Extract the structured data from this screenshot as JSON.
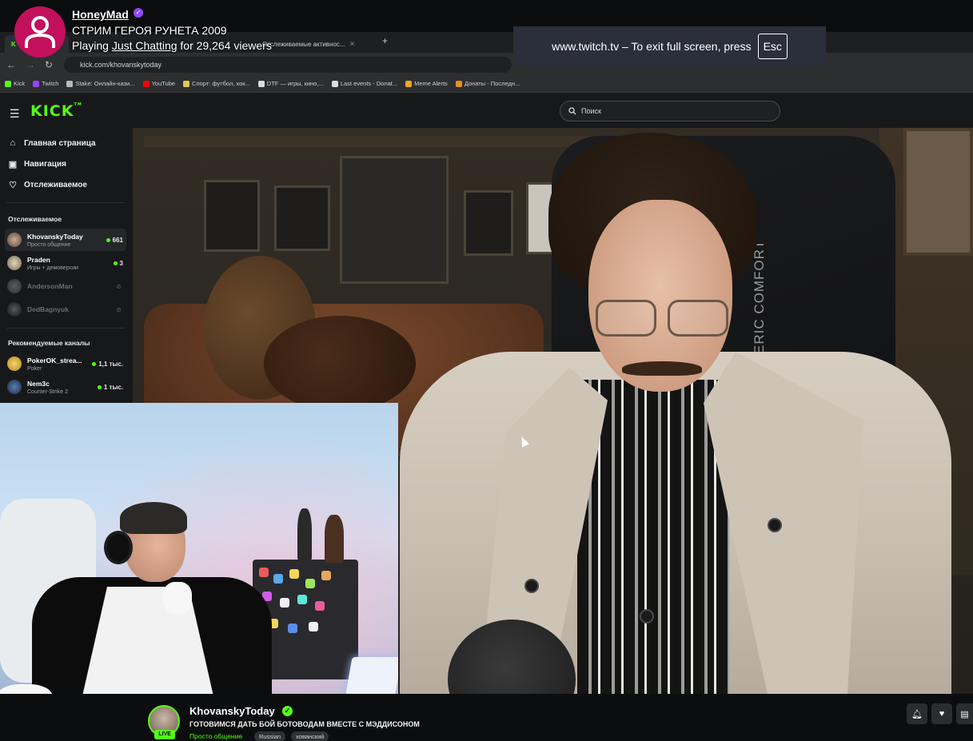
{
  "twitch": {
    "channel_name": "HoneyMad",
    "stream_title": "СТРИМ ГЕРОЯ РУНЕТА 2009",
    "playing_prefix": "Playing",
    "game": "Just Chatting",
    "viewers_text": "for 29,264 viewers"
  },
  "fullscreen_notice": {
    "text": "www.twitch.tv – To exit full screen, press",
    "key": "Esc"
  },
  "browser": {
    "tabs": [
      {
        "label": "K"
      },
      {
        "label": "Отслеживаемые активнос..."
      }
    ],
    "url": "kick.com/khovanskytoday",
    "bookmarks": [
      {
        "label": "Kick",
        "color": "#53fc18"
      },
      {
        "label": "Twitch",
        "color": "#9147ff"
      },
      {
        "label": "Stake: Онлайн-кази...",
        "color": "#bbbbbb"
      },
      {
        "label": "YouTube",
        "color": "#ff0000"
      },
      {
        "label": "Спорт: футбол, хок...",
        "color": "#e2c94a"
      },
      {
        "label": "DTF — игры, кино,...",
        "color": "#dddddd"
      },
      {
        "label": "Last events - Donat...",
        "color": "#dddddd"
      },
      {
        "label": "Meme Alerts",
        "color": "#f2a623"
      },
      {
        "label": "Донаты - Последн...",
        "color": "#f28c1c"
      }
    ]
  },
  "kick": {
    "logo": "KICK",
    "logo_mark": "TM",
    "search_placeholder": "Поиск",
    "nav": [
      {
        "label": "Главная страница",
        "icon": "home-icon"
      },
      {
        "label": "Навигация",
        "icon": "compass-icon"
      },
      {
        "label": "Отслеживаемое",
        "icon": "heart-icon"
      }
    ],
    "following_title": "Отслеживаемое",
    "following": [
      {
        "name": "KhovanskyToday",
        "category": "Просто общение",
        "viewers": "661",
        "live": true
      },
      {
        "name": "Praden",
        "category": "Игры + демоверсии",
        "viewers": "3",
        "live": true
      },
      {
        "name": "AndersonMan",
        "category": "",
        "viewers": "",
        "live": false
      },
      {
        "name": "DedBagnyuk",
        "category": "",
        "viewers": "",
        "live": false
      }
    ],
    "recommended_title": "Рекомендуемые каналы",
    "recommended": [
      {
        "name": "PokerOK_strea...",
        "category": "Poker",
        "viewers": "1,1 тыс."
      },
      {
        "name": "Nem3c",
        "category": "Counter-Strike 2",
        "viewers": "1 тыс."
      }
    ],
    "stream": {
      "streamer": "KhovanskyToday",
      "title": "ГОТОВИМСЯ ДАТЬ БОЙ БОТОВОДАМ ВМЕСТЕ С МЭДДИСОНОМ",
      "category": "Просто общение",
      "tags": [
        "Russian",
        "хованский"
      ],
      "live_label": "LIVE"
    },
    "chair_brand": "GENERIC COMFORT"
  }
}
